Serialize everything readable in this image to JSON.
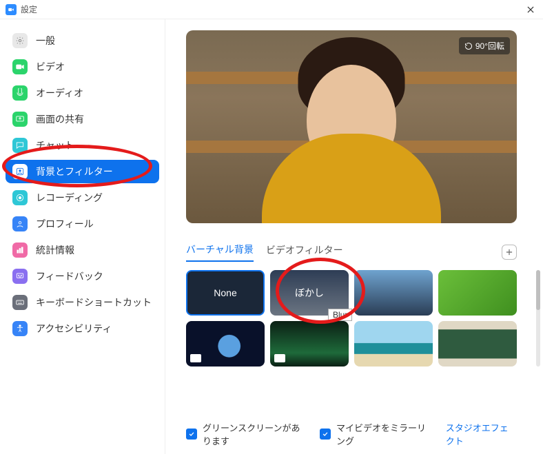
{
  "window": {
    "title": "設定"
  },
  "sidebar": {
    "items": [
      {
        "label": "一般",
        "icon": "general",
        "color": "#e8e8e8",
        "fg": "#777"
      },
      {
        "label": "ビデオ",
        "icon": "video",
        "color": "#2bd46b",
        "fg": "#fff"
      },
      {
        "label": "オーディオ",
        "icon": "audio",
        "color": "#2bd46b",
        "fg": "#fff"
      },
      {
        "label": "画面の共有",
        "icon": "share",
        "color": "#2bd46b",
        "fg": "#fff"
      },
      {
        "label": "チャット",
        "icon": "chat",
        "color": "#2ec7d6",
        "fg": "#fff"
      },
      {
        "label": "背景とフィルター",
        "icon": "background",
        "color": "#fff",
        "fg": "#0e72ed",
        "active": true
      },
      {
        "label": "レコーディング",
        "icon": "recording",
        "color": "#2ec7d6",
        "fg": "#fff"
      },
      {
        "label": "プロフィール",
        "icon": "profile",
        "color": "#3784f7",
        "fg": "#fff"
      },
      {
        "label": "統計情報",
        "icon": "stats",
        "color": "#f06aa6",
        "fg": "#fff"
      },
      {
        "label": "フィードバック",
        "icon": "feedback",
        "color": "#8a6ff0",
        "fg": "#fff"
      },
      {
        "label": "キーボードショートカット",
        "icon": "keyboard",
        "color": "#6b6f7a",
        "fg": "#fff"
      },
      {
        "label": "アクセシビリティ",
        "icon": "accessibility",
        "color": "#3784f7",
        "fg": "#fff"
      }
    ]
  },
  "preview": {
    "rotate_label": "90°回転"
  },
  "tabs": {
    "virtual_bg": "バーチャル背景",
    "video_filter": "ビデオフィルター"
  },
  "backgrounds": {
    "none_label": "None",
    "blur_label": "ぼかし",
    "blur_tooltip": "Blur"
  },
  "footer": {
    "green_screen": "グリーンスクリーンがあります",
    "mirror": "マイビデオをミラーリング",
    "studio": "スタジオエフェクト"
  }
}
